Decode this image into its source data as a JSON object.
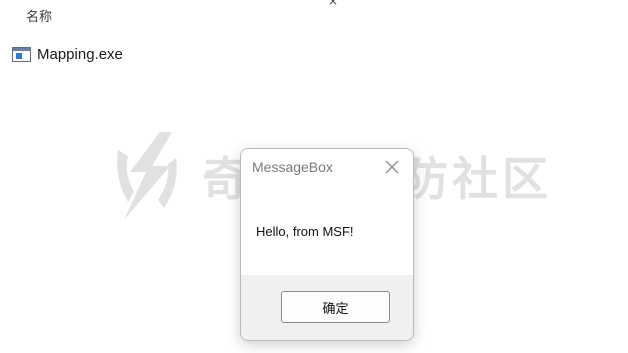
{
  "explorer": {
    "column_header": "名称",
    "top_close_glyph": "×",
    "file": {
      "icon": "exe-window-icon",
      "name": "Mapping.exe"
    }
  },
  "watermark": {
    "text": "奇安信攻防社区",
    "icon": "lightning-shield-logo"
  },
  "dialog": {
    "title": "MessageBox",
    "close_icon": "close-icon",
    "message": "Hello, from MSF!",
    "ok_label": "确定"
  }
}
